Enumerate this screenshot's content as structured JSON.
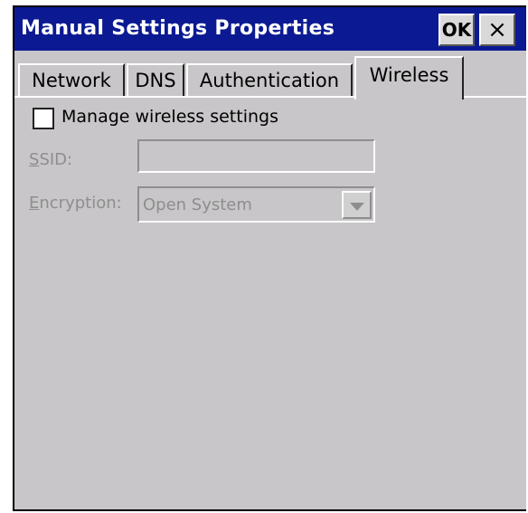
{
  "window": {
    "title": "Manual Settings Properties",
    "ok_label": "OK",
    "close_label": "×"
  },
  "tabs": [
    {
      "label": "Network",
      "active": false
    },
    {
      "label": "DNS",
      "active": false
    },
    {
      "label": "Authentication",
      "active": false
    },
    {
      "label": "Wireless",
      "active": true
    }
  ],
  "wireless": {
    "manage_checkbox_label": "Manage wireless settings",
    "manage_checked": false,
    "ssid_label_mnemonic": "S",
    "ssid_label_rest": "SID:",
    "ssid_value": "",
    "encryption_label_mnemonic": "E",
    "encryption_label_rest": "ncryption:",
    "encryption_value": "Open System"
  },
  "colors": {
    "titlebar": "#0b1a92",
    "dialog_bg": "#c8c6c8",
    "disabled_text": "#8e8e8e"
  },
  "icons": {
    "close": "close-icon",
    "dropdown": "chevron-down-icon"
  }
}
